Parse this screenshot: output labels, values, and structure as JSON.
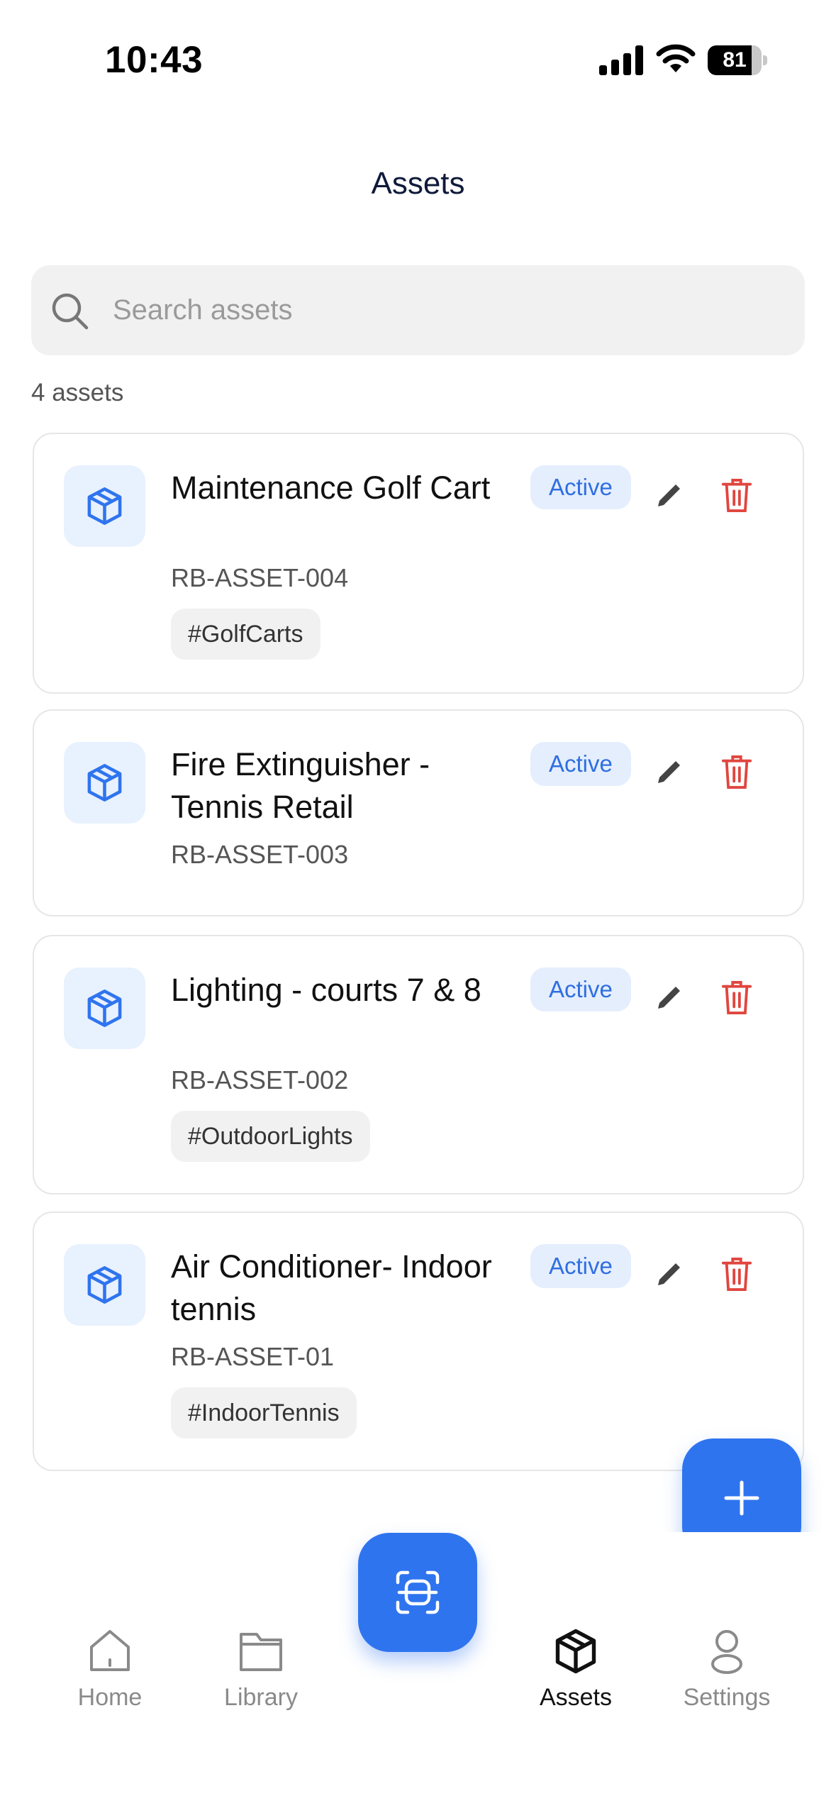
{
  "status_bar": {
    "time": "10:43",
    "battery": "81",
    "battery_level": 0.81
  },
  "header": {
    "title": "Assets"
  },
  "search": {
    "placeholder": "Search assets",
    "value": ""
  },
  "summary": {
    "count_label": "4 assets"
  },
  "assets": [
    {
      "title": "Maintenance Golf Cart",
      "code": "RB-ASSET-004",
      "status": "Active",
      "tag": "#GolfCarts"
    },
    {
      "title": "Fire Extinguisher - Tennis Retail",
      "code": "RB-ASSET-003",
      "status": "Active",
      "tag": ""
    },
    {
      "title": "Lighting - courts 7 & 8",
      "code": "RB-ASSET-002",
      "status": "Active",
      "tag": "#OutdoorLights"
    },
    {
      "title": "Air Conditioner- Indoor tennis",
      "code": "RB-ASSET-01",
      "status": "Active",
      "tag": "#IndoorTennis"
    }
  ],
  "nav": {
    "home": "Home",
    "library": "Library",
    "assets": "Assets",
    "settings": "Settings",
    "active": "assets"
  },
  "icons": {
    "asset": "box-icon",
    "edit": "pencil-icon",
    "delete": "trash-icon",
    "add": "plus-icon",
    "scan": "scan-icon"
  },
  "colors": {
    "accent": "#2f74ef",
    "status_active_text": "#2f6fe0",
    "status_active_bg": "#e5eefd",
    "delete": "#e0463f"
  }
}
